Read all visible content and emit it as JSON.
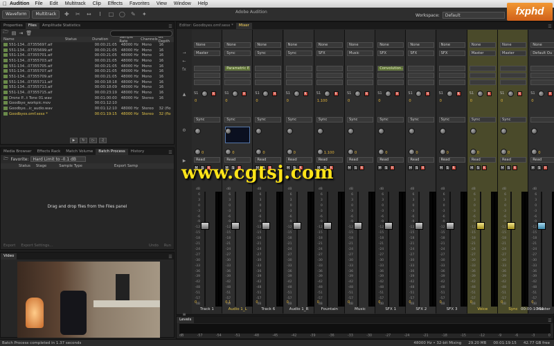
{
  "menubar": {
    "app": "Audition",
    "items": [
      "File",
      "Edit",
      "Multitrack",
      "Clip",
      "Effects",
      "Favorites",
      "View",
      "Window",
      "Help"
    ]
  },
  "window_title": "Adobe Audition",
  "toolbar": {
    "waveform": "Waveform",
    "multitrack": "Multitrack",
    "workspace_label": "Workspace:",
    "workspace_value": "Default"
  },
  "logo": "fxphd",
  "files_panel": {
    "tabs": [
      "Properties",
      "Files",
      "Amplitude Statistics"
    ],
    "columns": [
      "Name",
      "Status",
      "Duration",
      "Sample Rate",
      "Channels",
      "Bit Depth"
    ],
    "rows": [
      {
        "name": "551-134...07355697.aif",
        "duration": "00:00:21:05",
        "rate": "48000 Hz",
        "ch": "Mono",
        "bit": "16"
      },
      {
        "name": "551-134...07355699.aif",
        "duration": "00:00:21:05",
        "rate": "48000 Hz",
        "ch": "Mono",
        "bit": "16"
      },
      {
        "name": "551-134...07355701.aif",
        "duration": "00:00:21:05",
        "rate": "48000 Hz",
        "ch": "Mono",
        "bit": "16"
      },
      {
        "name": "551-134...07355703.aif",
        "duration": "00:00:21:05",
        "rate": "48000 Hz",
        "ch": "Mono",
        "bit": "16"
      },
      {
        "name": "551-134...07355705.aif",
        "duration": "00:00:21:05",
        "rate": "48000 Hz",
        "ch": "Mono",
        "bit": "16"
      },
      {
        "name": "551-134...07355707.aif",
        "duration": "00:00:21:05",
        "rate": "48000 Hz",
        "ch": "Mono",
        "bit": "16"
      },
      {
        "name": "551-134...07355709.aif",
        "duration": "00:00:21:05",
        "rate": "48000 Hz",
        "ch": "Mono",
        "bit": "16"
      },
      {
        "name": "551-134...07355711.aif",
        "duration": "00:00:18:18",
        "rate": "48000 Hz",
        "ch": "Mono",
        "bit": "16"
      },
      {
        "name": "551-134...07355713.aif",
        "duration": "00:00:18:09",
        "rate": "48000 Hz",
        "ch": "Mono",
        "bit": "16"
      },
      {
        "name": "551-134...07355715.aif",
        "duration": "00:00:23:19",
        "rate": "48000 Hz",
        "ch": "Mono",
        "bit": "16"
      },
      {
        "name": "Drone P...t Tone 01.wav",
        "duration": "00:01:00:00",
        "rate": "48000 Hz",
        "ch": "Stereo",
        "bit": "16"
      },
      {
        "name": "Goodbye_workpic.mov",
        "duration": "00:01:12:10",
        "rate": "",
        "ch": "",
        "bit": ""
      },
      {
        "name": "Goodbye...ic_audio.wav",
        "duration": "00:01:12:10",
        "rate": "48000 Hz",
        "ch": "Stereo",
        "bit": "32 (flo"
      },
      {
        "name": "Goodbyes.omf.sesx *",
        "duration": "00:01:19:15",
        "rate": "48000 Hz",
        "ch": "Stereo",
        "bit": "32 (flo"
      }
    ]
  },
  "batch_panel": {
    "tabs": [
      "Media Browser",
      "Effects Rack",
      "Match Volume",
      "Batch Process",
      "History"
    ],
    "favorite_label": "Favorite:",
    "favorite_value": "Hard Limit to -0.1 dB",
    "columns": [
      "Status",
      "Stage",
      "Sample Type",
      "Export Samp"
    ],
    "empty_text": "Drag and drop files from the Files panel",
    "footer": [
      "Export",
      "Export Settings...",
      "Undo",
      "Run"
    ]
  },
  "video_panel": {
    "title": "Video"
  },
  "mixer": {
    "editor_tab": "Editor: Goodbyes.omf.sesx *",
    "mixer_tab": "Mixer",
    "scale": [
      "dB",
      "6",
      "3",
      "0",
      "-3",
      "-6",
      "-9",
      "-12",
      "-15",
      "-18",
      "-21",
      "-24",
      "-27",
      "-30",
      "-33",
      "-36",
      "-39",
      "-42",
      "-48",
      "-51",
      "-57",
      "dB"
    ],
    "master_time": "00:00:10:11",
    "tracks": [
      {
        "name": "Track 1",
        "input": "None",
        "output": "Master",
        "send": "Sync",
        "fx": "",
        "pan": "0",
        "vol": "0",
        "active": false,
        "fader": 0.3,
        "color": ""
      },
      {
        "name": "Audio 1_L",
        "input": "None",
        "output": "Sync",
        "send": "Sync",
        "fx": "Parametric E...",
        "pan": "0",
        "vol": "0.1",
        "active": true,
        "fader": 0.3,
        "color": ""
      },
      {
        "name": "Track 6",
        "input": "None",
        "output": "Sync",
        "send": "Sync",
        "fx": "",
        "pan": "0",
        "vol": "0",
        "active": false,
        "fader": 0.3,
        "color": ""
      },
      {
        "name": "Audio 1_R",
        "input": "None",
        "output": "Sync",
        "send": "Sync",
        "fx": "",
        "pan": "0",
        "vol": "0",
        "active": false,
        "fader": 0.3,
        "color": ""
      },
      {
        "name": "Fountain",
        "input": "None",
        "output": "SFX",
        "send": "Sync",
        "fx": "",
        "pan": "1.100",
        "vol": "0",
        "active": false,
        "fader": 0.3,
        "color": ""
      },
      {
        "name": "Music",
        "input": "None",
        "output": "Music",
        "send": "Sync",
        "fx": "",
        "pan": "0",
        "vol": "0",
        "active": false,
        "fader": 0.3,
        "color": ""
      },
      {
        "name": "SFX 1",
        "input": "None",
        "output": "SFX",
        "send": "Sync",
        "fx": "Convolution...",
        "pan": "0",
        "vol": "0",
        "active": false,
        "fader": 0.3,
        "color": ""
      },
      {
        "name": "SFX 2",
        "input": "None",
        "output": "SFX",
        "send": "Sync",
        "fx": "",
        "pan": "0",
        "vol": "0",
        "active": false,
        "fader": 0.3,
        "color": ""
      },
      {
        "name": "SFX 3",
        "input": "None",
        "output": "SFX",
        "send": "Sync",
        "fx": "",
        "pan": "0",
        "vol": "0",
        "active": false,
        "fader": 0.3,
        "color": ""
      },
      {
        "name": "Voice",
        "input": "None",
        "output": "Master",
        "send": "Sync",
        "fx": "",
        "pan": "0",
        "vol": "0",
        "active": true,
        "fader": 0.3,
        "color": "#c9b427"
      },
      {
        "name": "Sync",
        "input": "None",
        "output": "Master",
        "send": "Sync",
        "fx": "",
        "pan": "0",
        "vol": "0",
        "active": true,
        "fader": 0.3,
        "color": "#c9b427"
      },
      {
        "name": "Master",
        "input": "None",
        "output": "Default Ou",
        "send": "",
        "fx": "",
        "pan": "0",
        "vol": "0",
        "active": false,
        "fader": 0.3,
        "color": "#3c87a8"
      }
    ],
    "mode_label": "Read"
  },
  "watermark": "www.cgtsj.com",
  "levels": {
    "title": "Levels",
    "scale": [
      "dB",
      "-57",
      "-54",
      "-51",
      "-48",
      "-45",
      "-42",
      "-39",
      "-36",
      "-33",
      "-30",
      "-27",
      "-24",
      "-21",
      "-18",
      "-15",
      "-12",
      "-9",
      "-6",
      "-3",
      "0"
    ]
  },
  "status": {
    "left": "Batch Process completed in 1.37 seconds",
    "rate": "48000 Hz • 32-bit Mixing",
    "mem": "29.20 MB",
    "time": "00:01:19:15",
    "disk": "42.77 GB free"
  },
  "colors": {
    "accent": "#e5c64a",
    "rec": "#c23a2c",
    "fx_on": "#5b6f34"
  }
}
